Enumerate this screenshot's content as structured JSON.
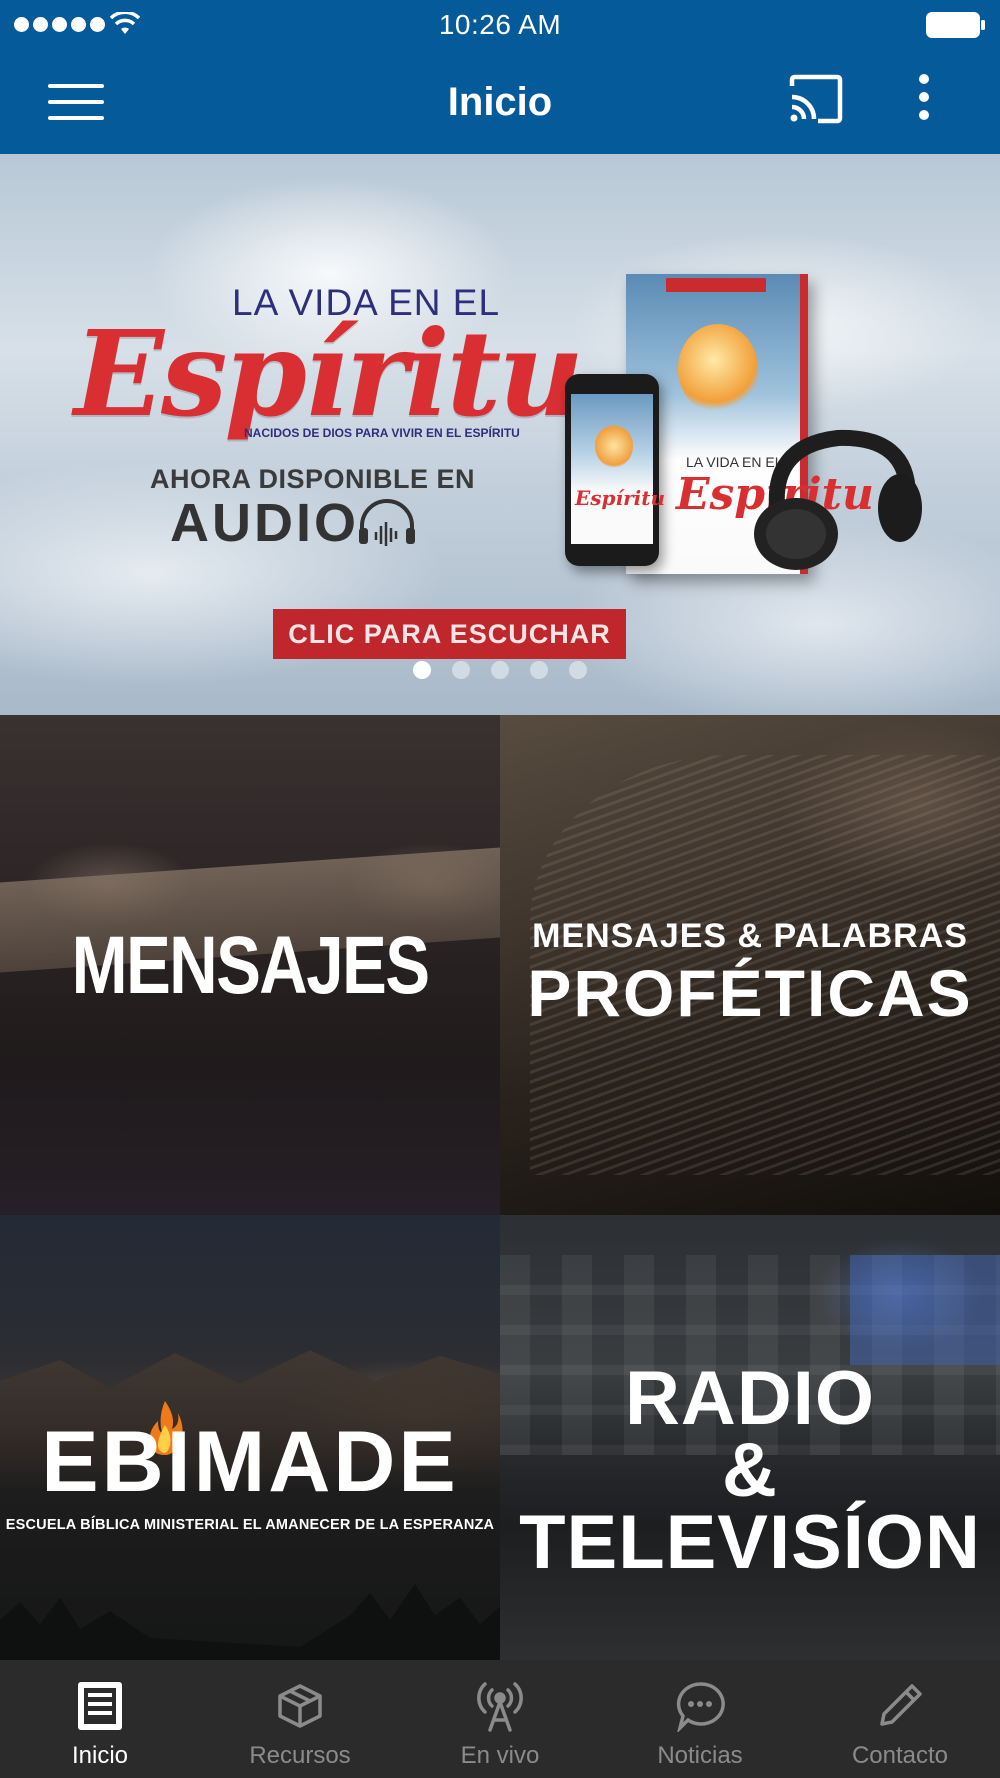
{
  "status_bar": {
    "time": "10:26 AM",
    "signal_icon": "signal-dots-icon",
    "wifi_icon": "wifi-icon",
    "battery_icon": "battery-icon"
  },
  "app_bar": {
    "title": "Inicio",
    "menu_icon": "hamburger-menu-icon",
    "cast_icon": "cast-icon",
    "more_icon": "more-vertical-icon",
    "background_color": "#055a9a"
  },
  "banner": {
    "line1": "LA VIDA EN EL",
    "script_title": "Espíritu",
    "subtitle": "NACIDOS DE DIOS PARA VIVIR EN EL ESPÍRITU",
    "available_line": "AHORA DISPONIBLE EN",
    "audio_word": "AUDIO",
    "cta_label": "CLIC PARA ESCUCHAR",
    "book_cover_line": "LA VIDA EN EL",
    "book_cover_script": "Espíritu",
    "dots_count": 5,
    "active_dot": 1,
    "accent_color": "#c0272d"
  },
  "tiles": [
    {
      "id": "mensajes",
      "label": "MENSAJES"
    },
    {
      "id": "profeticas",
      "label_small": "MENSAJES & PALABRAS",
      "label_big": "PROFÉTICAS"
    },
    {
      "id": "ebimade",
      "label": "EBIMADE",
      "sub": "ESCUELA BÍBLICA MINISTERIAL EL AMANECER DE LA ESPERANZA"
    },
    {
      "id": "radio",
      "line1": "RADIO",
      "line2": "&",
      "line3": "TELEVISÍON"
    }
  ],
  "bottom_nav": {
    "items": [
      {
        "label": "Inicio",
        "icon": "document-icon",
        "active": true
      },
      {
        "label": "Recursos",
        "icon": "box-icon",
        "active": false
      },
      {
        "label": "En vivo",
        "icon": "broadcast-icon",
        "active": false
      },
      {
        "label": "Noticias",
        "icon": "chat-bubble-icon",
        "active": false
      },
      {
        "label": "Contacto",
        "icon": "pencil-icon",
        "active": false
      }
    ],
    "active_color": "#ffffff",
    "inactive_color": "#8b8b8b"
  }
}
